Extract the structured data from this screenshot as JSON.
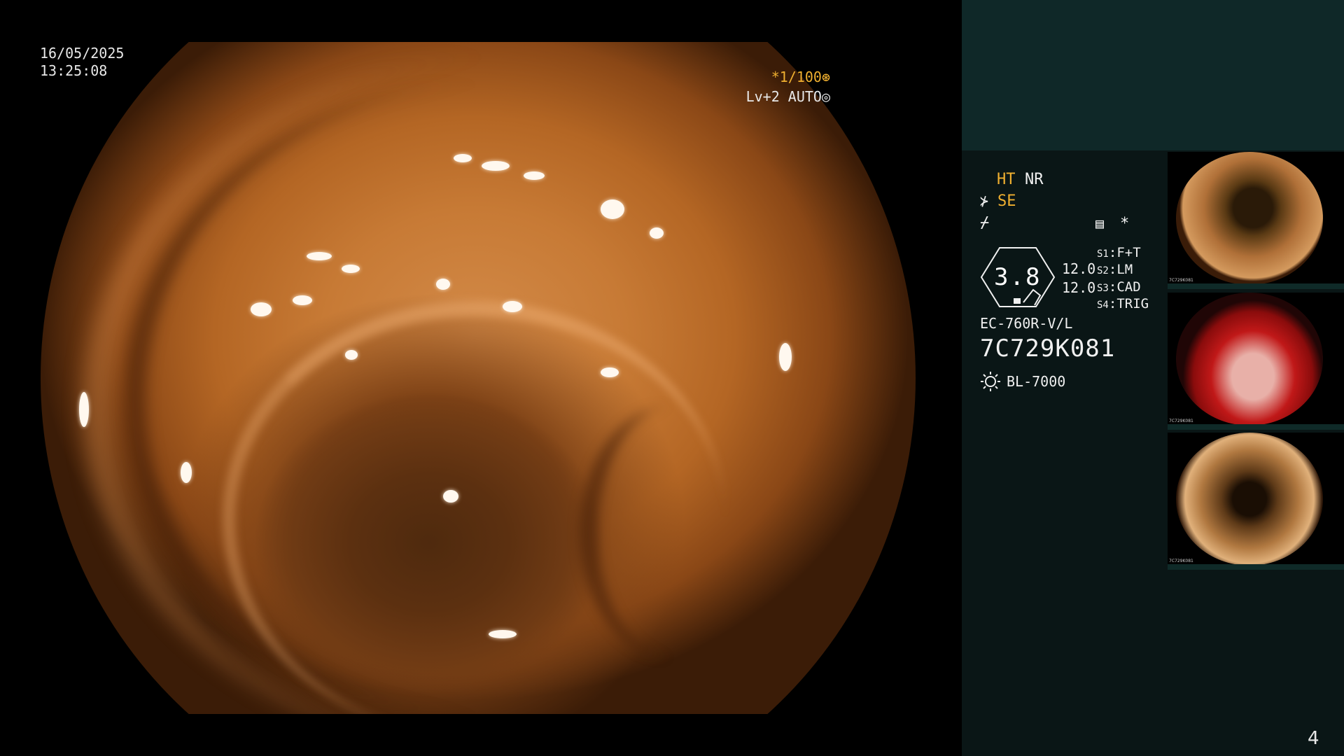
{
  "overlay": {
    "date": "16/05/2025",
    "time": "13:25:08",
    "shutter": "*1/100⊛",
    "iris": "Lv+2 AUTO◎"
  },
  "panel": {
    "ht": "HT",
    "nr": "NR",
    "se_icon": "⊁",
    "se": "SE",
    "flat_icon": "⌿",
    "memo_icon": "▤",
    "star": "*",
    "gauge_value": "3.8",
    "value1": "12.0",
    "value2": "12.0",
    "switches": [
      {
        "key": "S1",
        "label": "F+T"
      },
      {
        "key": "S2",
        "label": "LM"
      },
      {
        "key": "S3",
        "label": "CAD"
      },
      {
        "key": "S4",
        "label": "TRIG"
      }
    ],
    "scope_model": "EC-760R-V/L",
    "serial": "7C729K081",
    "light_source": "BL-7000",
    "page_number": "4",
    "accent_color": "#f0b030"
  },
  "thumbnails": [
    {
      "name": "thumbnail-1",
      "serial": "7C729K081"
    },
    {
      "name": "thumbnail-2",
      "serial": "7C729K081"
    },
    {
      "name": "thumbnail-3",
      "serial": "7C729K081"
    }
  ]
}
